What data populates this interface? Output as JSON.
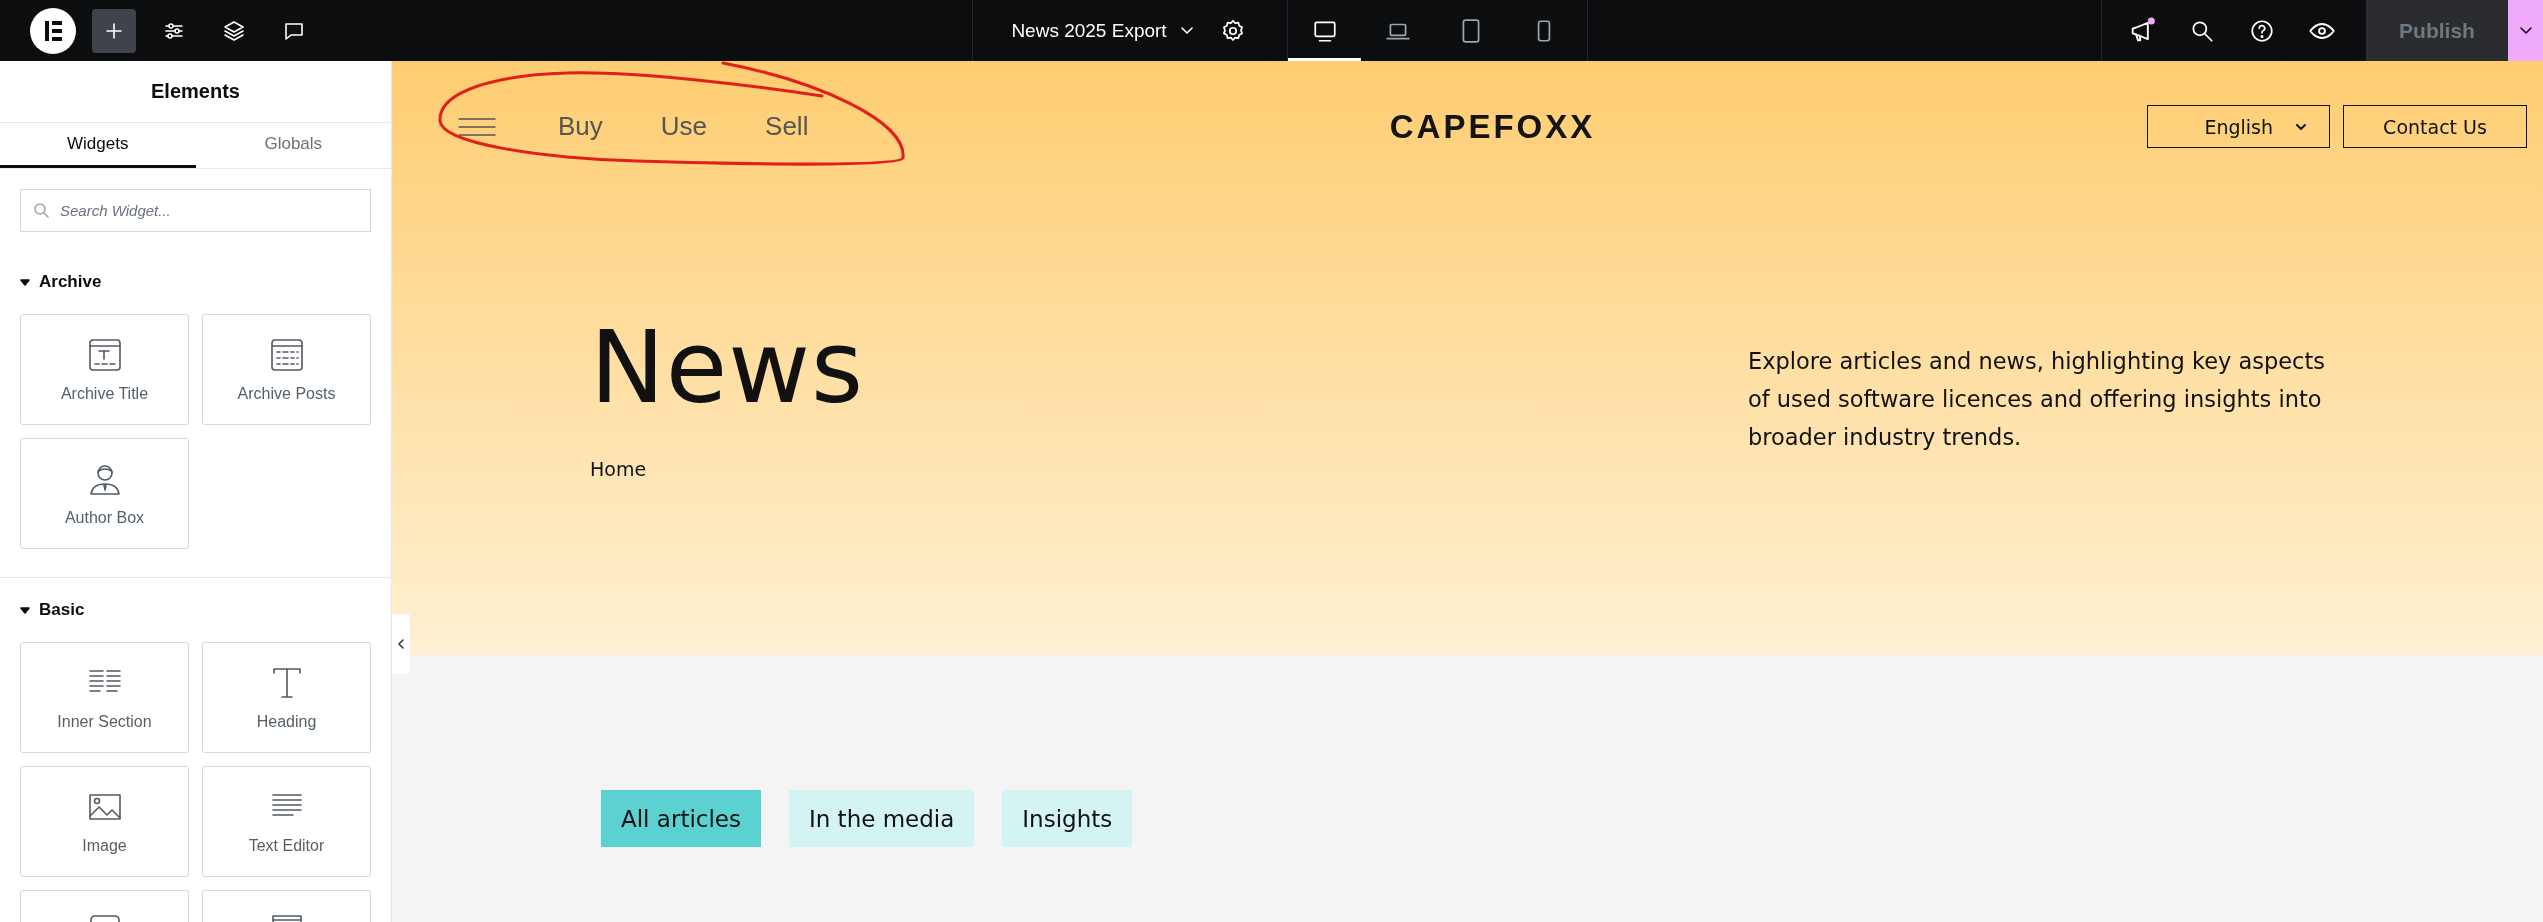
{
  "editor_toolbar": {
    "document_title": "News 2025 Export",
    "device_modes": [
      {
        "selected": true
      },
      {
        "selected": false
      },
      {
        "selected": false
      },
      {
        "selected": false
      }
    ],
    "publish_button": "Publish"
  },
  "sidebar": {
    "title": "Elements",
    "tabs": [
      {
        "label": "Widgets",
        "selected": true
      },
      {
        "label": "Globals",
        "selected": false
      }
    ],
    "search": {
      "placeholder": "Search Widget..."
    },
    "categories": [
      {
        "name": "Archive",
        "expanded": true,
        "widgets": [
          {
            "kind": "widget",
            "label": "Archive Title"
          },
          {
            "kind": "widget",
            "label": "Archive Posts"
          },
          {
            "kind": "widget",
            "label": "Author Box"
          }
        ]
      },
      {
        "name": "Basic",
        "expanded": true,
        "widgets": [
          {
            "kind": "widget",
            "label": "Inner Section"
          },
          {
            "kind": "widget",
            "label": "Heading"
          },
          {
            "kind": "widget",
            "label": "Image"
          },
          {
            "kind": "widget",
            "label": "Text Editor"
          },
          {
            "kind": "partial"
          },
          {
            "kind": "partial"
          }
        ]
      }
    ]
  },
  "page": {
    "nav_links": [
      "Buy",
      "Use",
      "Sell"
    ],
    "logo": "CAPEFOXX",
    "language_select": {
      "value": "English"
    },
    "contact_button": "Contact Us",
    "heading": "News",
    "breadcrumb": "Home",
    "intro": "Explore articles and news, highlighting key aspects of used software licences and offering insights into broader industry trends.",
    "filters": [
      {
        "label": "All articles",
        "selected": true
      },
      {
        "label": "In the media",
        "selected": false
      },
      {
        "label": "Insights",
        "selected": false
      }
    ]
  }
}
